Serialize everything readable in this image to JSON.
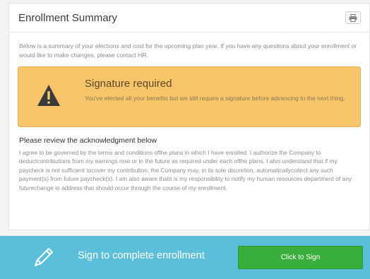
{
  "summary": {
    "title": "Enrollment Summary",
    "print_icon": "printer-icon",
    "intro": "Below is a summary of your elections and cost for the upcoming plan year. If you have any questions about your enrollment or would like to make changes, please contact HR."
  },
  "alert": {
    "icon": "warning-triangle-icon",
    "title": "Signature required",
    "text": "You've elected all your benefits but we still require a signature before advancing to the next thing.",
    "color": "#f7c46a"
  },
  "acknowledgment": {
    "title": "Please review the acknowledgment below",
    "text": "I agree to be governed by the terms and conditions ofthe plans in which I have enrolled. I authorize the Company to deductcontributions from my earnings now or in the future as required under each ofthe plans. I also understand that if my paycheck is not sufficient tocover my contribution, the Company may, in its sole discretion, automaticallycollect any such payment(s) from future paycheck(s). I am also aware thatit is my responsibility to notify my human resources department of any futurechange in address that should occur through the course of my enrollment."
  },
  "sign_bar": {
    "icon": "pencil-icon",
    "label": "Sign to complete enrollment",
    "button_label": "Click to Sign",
    "bar_color": "#5bbfd9",
    "button_color": "#3aae3a"
  }
}
